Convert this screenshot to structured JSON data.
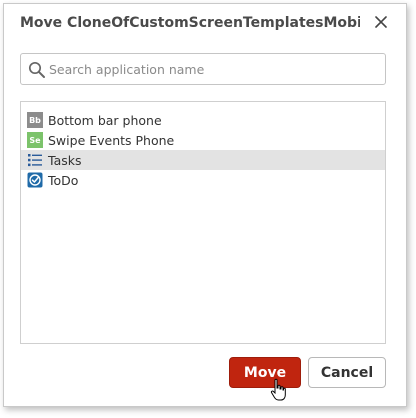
{
  "dialog": {
    "title": "Move CloneOfCustomScreenTemplatesMobile to...",
    "close_icon": "close-icon"
  },
  "search": {
    "placeholder": "Search application name",
    "value": "",
    "icon": "search-icon"
  },
  "apps": [
    {
      "label": "Bottom bar phone",
      "icon_text": "Bb",
      "icon_color": "#8c8c8c",
      "selected": false
    },
    {
      "label": "Swipe Events Phone",
      "icon_text": "Se",
      "icon_color": "#7cc36b",
      "selected": false
    },
    {
      "label": "Tasks",
      "icon_text": "",
      "icon_color": "#2a5b9a",
      "selected": true
    },
    {
      "label": "ToDo",
      "icon_text": "",
      "icon_color": "#1f6aa8",
      "selected": false
    }
  ],
  "buttons": {
    "move_label": "Move",
    "cancel_label": "Cancel"
  },
  "colors": {
    "move_button": "#c0250f",
    "selected_row": "#e3e3e3"
  }
}
